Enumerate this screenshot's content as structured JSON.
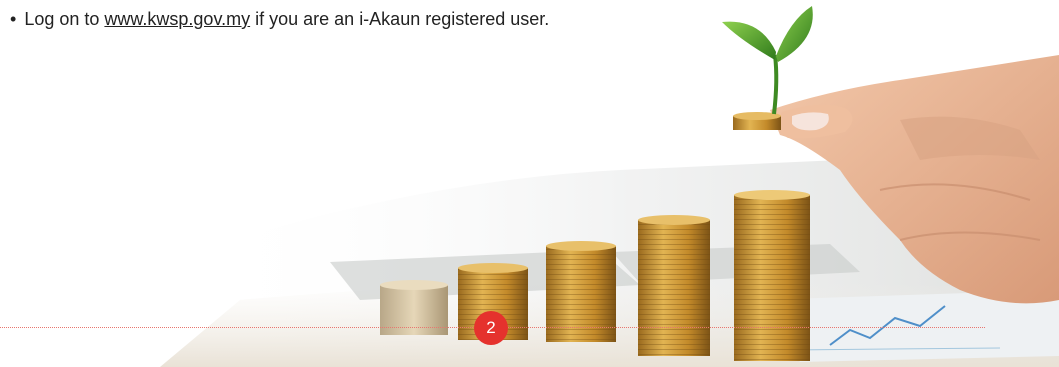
{
  "instruction": {
    "bullet": "•",
    "text_before": "Log on to",
    "link_text": "www.kwsp.gov.my",
    "text_after": "if you are an i-Akaun registered user."
  },
  "illustration": {
    "icon": "hand-holding-coin-with-sprout-image",
    "colors": {
      "coin_gold": "#c9952f",
      "leaf_green": "#4e9a2a",
      "skin": "#e9b89a"
    }
  },
  "footer": {
    "page_number": "2",
    "badge_color": "#e5322d",
    "rule_color": "#e8766f"
  }
}
